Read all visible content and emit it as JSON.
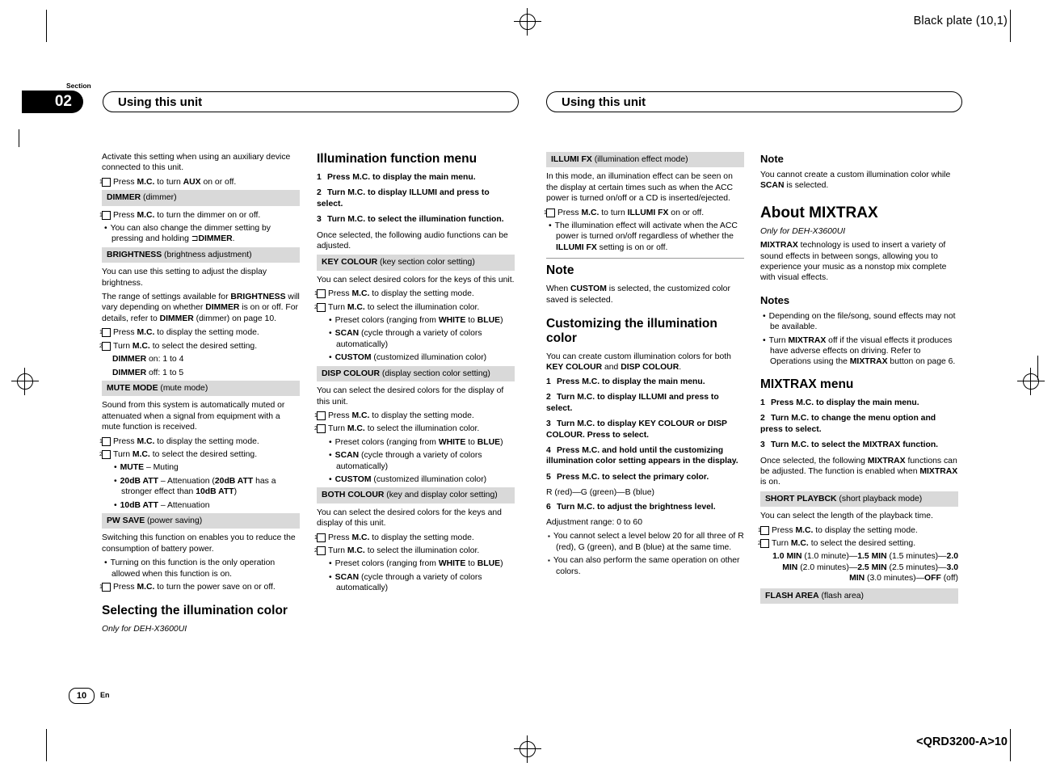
{
  "page": {
    "black_plate": "Black plate (10,1)",
    "footer_code": "<QRD3200-A>10",
    "section_word": "Section",
    "section_number": "02",
    "page_number": "10",
    "language_mark": "En"
  },
  "running_heads": {
    "left": "Using this unit",
    "right": "Using this unit"
  },
  "col1": {
    "aux_note": "Activate this setting when using an auxiliary device connected to this unit.",
    "aux_step1": "Press M.C. to turn AUX on or off.",
    "dimmer_title": "DIMMER",
    "dimmer_title_sub": "(dimmer)",
    "dimmer_step1": "Press M.C. to turn the dimmer on or off.",
    "dimmer_bullet": "You can also change the dimmer setting by pressing and holding ⊐DIMMER.",
    "brightness_title": "BRIGHTNESS",
    "brightness_title_sub": "(brightness adjustment)",
    "brightness_p1": "You can use this setting to adjust the display brightness.",
    "brightness_p2": "The range of settings available for BRIGHTNESS will vary depending on whether DIMMER is on or off. For details, refer to DIMMER (dimmer) on page 10.",
    "brightness_step1": "Press M.C. to display the setting mode.",
    "brightness_step2": "Turn M.C. to select the desired setting.",
    "brightness_on": "DIMMER on: 1 to 4",
    "brightness_off": "DIMMER off: 1 to 5",
    "mute_title": "MUTE MODE",
    "mute_title_sub": "(mute mode)",
    "mute_p1": "Sound from this system is automatically muted or attenuated when a signal from equipment with a mute function is received.",
    "mute_step1": "Press M.C. to display the setting mode.",
    "mute_step2": "Turn M.C. to select the desired setting.",
    "mute_b1": "MUTE – Muting",
    "mute_b2": "20dB ATT – Attenuation (20dB ATT has a stronger effect than 10dB ATT)",
    "mute_b3": "10dB ATT – Attenuation",
    "pwsave_title": "PW SAVE",
    "pwsave_title_sub": "(power saving)",
    "pwsave_p1": "Switching this function on enables you to reduce the consumption of battery power.",
    "pwsave_b1": "Turning on this function is the only operation allowed when this function is on.",
    "pwsave_step1": "Press M.C. to turn the power save on or off.",
    "illum_heading": "Selecting the illumination color",
    "illum_italic": "Only for DEH-X3600UI"
  },
  "col2": {
    "heading": "Illumination function menu",
    "step1": "Press M.C. to display the main menu.",
    "step2": "Turn M.C. to display ILLUMI and press to select.",
    "step3": "Turn M.C. to select the illumination function.",
    "step3_note": "Once selected, the following audio functions can be adjusted.",
    "key_title": "KEY COLOUR",
    "key_title_sub": "(key section color setting)",
    "key_p1": "You can select desired colors for the keys of this unit.",
    "key_s1": "Press M.C. to display the setting mode.",
    "key_s2": "Turn M.C. to select the illumination color.",
    "key_b1": "Preset colors (ranging from WHITE to BLUE)",
    "key_b2": "SCAN (cycle through a variety of colors automatically)",
    "key_b3": "CUSTOM (customized illumination color)",
    "disp_title": "DISP COLOUR",
    "disp_title_sub": "(display section color setting)",
    "disp_p1": "You can select the desired colors for the display of this unit.",
    "disp_s1": "Press M.C. to display the setting mode.",
    "disp_s2": "Turn M.C. to select the illumination color.",
    "disp_b1": "Preset colors (ranging from WHITE to BLUE)",
    "disp_b2": "SCAN (cycle through a variety of colors automatically)",
    "disp_b3": "CUSTOM (customized illumination color)",
    "both_title": "BOTH COLOUR",
    "both_title_sub": "(key and display color setting)",
    "both_p1": "You can select the desired colors for the keys and display of this unit.",
    "both_s1": "Press M.C. to display the setting mode.",
    "both_s2": "Turn M.C. to select the illumination color.",
    "both_b1": "Preset colors (ranging from WHITE to BLUE)",
    "both_b2": "SCAN (cycle through a variety of colors automatically)"
  },
  "col3": {
    "illumifx_title": "ILLUMI FX",
    "illumifx_title_sub": "(illumination effect mode)",
    "illumifx_p1": "In this mode, an illumination effect can be seen on the display at certain times such as when the ACC power is turned on/off or a CD is inserted/ejected.",
    "illumifx_s1": "Press M.C. to turn ILLUMI FX on or off.",
    "illumifx_b1": "The illumination effect will activate when the ACC power is turned on/off regardless of whether the ILLUMI FX setting is on or off.",
    "note_heading": "Note",
    "note_text": "When CUSTOM is selected, the customized color saved is selected.",
    "custom_heading": "Customizing the illumination color",
    "custom_p1": "You can create custom illumination colors for both KEY COLOUR and DISP COLOUR.",
    "c_step1": "Press M.C. to display the main menu.",
    "c_step2": "Turn M.C. to display ILLUMI and press to select.",
    "c_step3": "Turn M.C. to display KEY COLOUR or DISP COLOUR. Press to select.",
    "c_step4": "Press M.C. and hold until the customizing illumination color setting appears in the display.",
    "c_step5": "Press M.C. to select the primary color.",
    "c_step5_sub": "R (red)—G (green)—B (blue)",
    "c_step6": "Turn M.C. to adjust the brightness level.",
    "c_step6_sub": "Adjustment range: 0 to 60",
    "c_sq1": "You cannot select a level below 20 for all three of R (red), G (green), and B (blue) at the same time.",
    "c_sq2": "You can also perform the same operation on other colors."
  },
  "col4": {
    "note_heading": "Note",
    "note_text": "You cannot create a custom illumination color while SCAN is selected.",
    "mixtrax_heading": "About MIXTRAX",
    "mixtrax_italic": "Only for DEH-X3600UI",
    "mixtrax_p1": "MIXTRAX technology is used to insert a variety of sound effects in between songs, allowing you to experience your music as a nonstop mix complete with visual effects.",
    "notes_heading": "Notes",
    "notes_b1": "Depending on the file/song, sound effects may not be available.",
    "notes_b2": "Turn MIXTRAX off if the visual effects it produces have adverse effects on driving. Refer to Operations using the MIXTRAX button on page 6.",
    "menu_heading": "MIXTRAX menu",
    "m_step1": "Press M.C. to display the main menu.",
    "m_step2": "Turn M.C. to change the menu option and press to select.",
    "m_step3": "Turn M.C. to select the MIXTRAX function.",
    "m_step3_note": "Once selected, the following MIXTRAX functions can be adjusted. The function is enabled when MIXTRAX is on.",
    "short_title": "SHORT PLAYBCK",
    "short_title_sub": "(short playback mode)",
    "short_p1": "You can select the length of the playback time.",
    "short_s1": "Press M.C. to display the setting mode.",
    "short_s2": "Turn M.C. to select the desired setting.",
    "short_vals": "1.0 MIN (1.0 minute)—1.5 MIN (1.5 minutes)—2.0 MIN (2.0 minutes)—2.5 MIN (2.5 minutes)—3.0 MIN (3.0 minutes)—OFF (off)",
    "flash_title": "FLASH AREA",
    "flash_title_sub": "(flash area)"
  }
}
